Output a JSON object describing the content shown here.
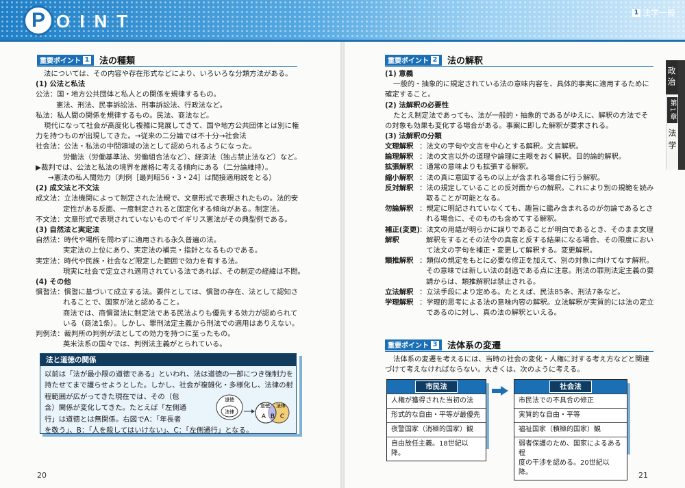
{
  "banner": {
    "p_letter": "P",
    "title_rest": "OINT",
    "chapter_num": "1",
    "chapter_label": "法学一般"
  },
  "left": {
    "section1": {
      "badge": "重要ポイント",
      "num": "1",
      "title": "法の種類"
    },
    "lines": [
      "法については、その内容や存在形式などにより、いろいろな分類方法がある。",
      "(1) 公法と私法",
      "公法：国・地方公共団体と私人との関係を規律するもの。",
      "憲法、刑法、民事訴訟法、刑事訴訟法、行政法など。",
      "私法：私人間の関係を規律するもの。民法、商法など。",
      "現代になって社会が高度化し複雑に発展してきて、国や地方公共団体とは別に権",
      "力を持つものが出現してきた。→従来の二分論では不十分→社会法",
      "社会法：公法・私法の中間領域の法として認められるようになった。",
      "労働法（労働基準法、労働組合法など）、経済法（独占禁止法など）など。",
      "▶裁判では、公法と私法の境界を厳格に考える傾向にある（二分論維持）。",
      "→憲法の私人間効力（判例［最判昭56・3・24］は間接適用説をとる）",
      "(2) 成文法と不文法",
      "成文法：立法機関によって制定された法規で、文章形式で表現されたもの。法的安",
      "定性がある反面、一度制定されると固定化する傾向がある。制定法。",
      "不文法：文章形式で表現されていないものでイギリス憲法がその典型例である。",
      "(3) 自然法と実定法",
      "自然法：時代や場所を問わずに適用される永久普遍の法。",
      "実定法の上位にあり、実定法の補完・指針となるものである。",
      "実定法：時代や民族・社会など限定した範囲で効力を有する法。",
      "現実に社会で定立され適用されている法であれば、その制定の経緯は不問。",
      "(4) その他",
      "慣習法：慣習に基づいて成立する法。要件としては、慣習の存在、法として認知さ",
      "れることで、国家が法と認めること。",
      "商法では、商慣習法に制定法である民法よりも優先する効力が認められて",
      "いる（商法1条）。しかし、罪刑法定主義から刑法での適用はありえない。",
      "判例法：裁判所の判例が法としての効力を持つに至ったもの。",
      "英米法系の国々では、判例法主義がとられている。"
    ],
    "box": {
      "title": "法と道徳の関係",
      "lines": [
        "以前は「法が最小限の道徳である」といわれ、法は道徳の一部につき強制力を",
        "持たせてまで護らせようとした。しかし、社会が複雑化・多様化し、法律の射",
        "程範囲が広がってきた現在では、その（包",
        "含）関係が変化してきた。たとえば「左側通",
        "行」は道徳とは無関係。右図でA：「年長者",
        "を敬う」、B：「人を殺してはいけない」、C：「左側通行」となる。"
      ],
      "venn": {
        "outer_top": "道徳",
        "outer_inner": "法律",
        "left_label": "道徳",
        "right_label": "法律",
        "a": "A",
        "b": "B",
        "c": "C"
      }
    },
    "page_number": "20"
  },
  "right": {
    "section2": {
      "badge": "重要ポイント",
      "num": "2",
      "title": "法の解釈"
    },
    "s2_lines": [
      "(1) 意義",
      "一般的・抽象的に規定されている法の意味内容を、具体的事実に適用するために",
      "確定すること。",
      "(2) 法解釈の必要性",
      "たとえ制定法であっても、法が一般的・抽象的であるがゆえに、解釈の方法でそ",
      "の対象も効果も変化する場合がある。事案に即した解釈が要求される。",
      "(3) 法解釈の分類"
    ],
    "terms": [
      {
        "t": "文理解釈",
        "d": [
          "：法文の字句や文言を中心とする解釈。文言解釈。"
        ]
      },
      {
        "t": "論理解釈",
        "d": [
          "：法の文言以外の道理や論理に主眼をおく解釈。目的論的解釈。"
        ]
      },
      {
        "t": "拡張解釈",
        "d": [
          "：通常の意味よりも拡張する解釈。"
        ]
      },
      {
        "t": "縮小解釈",
        "d": [
          "：法の真に意図するもの以上が含まれる場合に行う解釈。"
        ]
      },
      {
        "t": "反対解釈",
        "d": [
          "：法の規定していることの反対面からの解釈。これにより別の規範を読み",
          "取ることが可能となる。"
        ]
      },
      {
        "t": "勿論解釈",
        "d": [
          "：規定に明記されていなくても、趣旨に鑑み含まれるのが勿論であるとさ",
          "れる場合に、そのものも含めてする解釈。"
        ]
      },
      {
        "t": "補正(変更)",
        "t2": "解釈",
        "d": [
          "：法文の用語が明らかに誤りであることが明白であるとき、そのまま文理",
          "解釈をするとその法令の真意と反する結果になる場合、その限度におい",
          "て法文の字句を補正・変更して解釈する。変更解釈。"
        ]
      },
      {
        "t": "類推解釈",
        "d": [
          "：類似の規定をもとに必要な修正を加えて、別の対象に向けてなす解釈。",
          "その意味では新しい法の創造である点に注意。刑法の罪刑法定主義の要",
          "請からは、類推解釈は禁止される。"
        ]
      },
      {
        "t": "立法解釈",
        "d": [
          "：立法手段により定める。たとえば、民法85条、刑法7条など。"
        ]
      },
      {
        "t": "学理解釈",
        "d": [
          "：学理的思考による法の意味内容の解釈。立法解釈が実質的には法の定立",
          "であるのに対し、真の法の解釈といえる。"
        ]
      }
    ],
    "furigana": "もちろん",
    "section3": {
      "badge": "重要ポイント",
      "num": "3",
      "title": "法体系の変遷"
    },
    "s3_lines": [
      "法体系の変遷を考えるには、当時の社会の変化・人権に対する考え方などと関連",
      "づけて考えなければならない。大きくは、次のように考える。"
    ],
    "table_left": {
      "header": "市民法",
      "rows": [
        "人権が獲得された当初の法",
        "形式的な自由・平等が最優先",
        "夜警国家（消極的国家）観",
        "自由放任主義。18世紀以降。"
      ]
    },
    "table_right": {
      "header": "社会法",
      "rows": [
        "市民法での不具合の修正",
        "実質的な自由・平等",
        "福祉国家（積極的国家）観",
        "弱者保護のため、国家によるある程\n度の干渉を認める。20世紀以降。"
      ]
    },
    "side_tab": {
      "subject": "政治",
      "chapter_badge": "第1章",
      "chapter_name": "法学"
    },
    "page_number": "21"
  },
  "colors": {
    "accent": "#1a6fb5",
    "box_head": "#123c5e",
    "box_bg": "#eaf4fb"
  },
  "icons": [
    "arrow-right-icon"
  ]
}
